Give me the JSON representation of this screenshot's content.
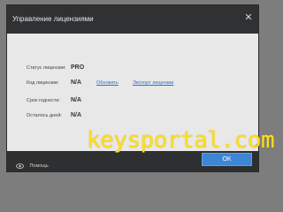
{
  "dialog": {
    "title": "Управление лицензиями",
    "close_glyph": "✕"
  },
  "license": {
    "rows": [
      {
        "label": "Статус лицензии:",
        "value": "PRO"
      },
      {
        "label": "Код лицензии:",
        "value": "N/A"
      },
      {
        "label": "Срок годности:",
        "value": "N/A"
      },
      {
        "label": "Осталось дней:",
        "value": "N/A"
      }
    ],
    "refresh_link": "Обновить",
    "export_link": "Экспорт лицензии"
  },
  "footer": {
    "help_label": "Помощь",
    "help_icon": "eye-icon",
    "ok_label": "OK"
  },
  "watermark": {
    "text": "keysportal.com",
    "color": "#ffde1f"
  },
  "colors": {
    "titlebar": "#2f3133",
    "content_bg": "#e8e8e8",
    "footer": "#2d2f31",
    "accent": "#3d86d6",
    "link": "#2b73c9"
  }
}
